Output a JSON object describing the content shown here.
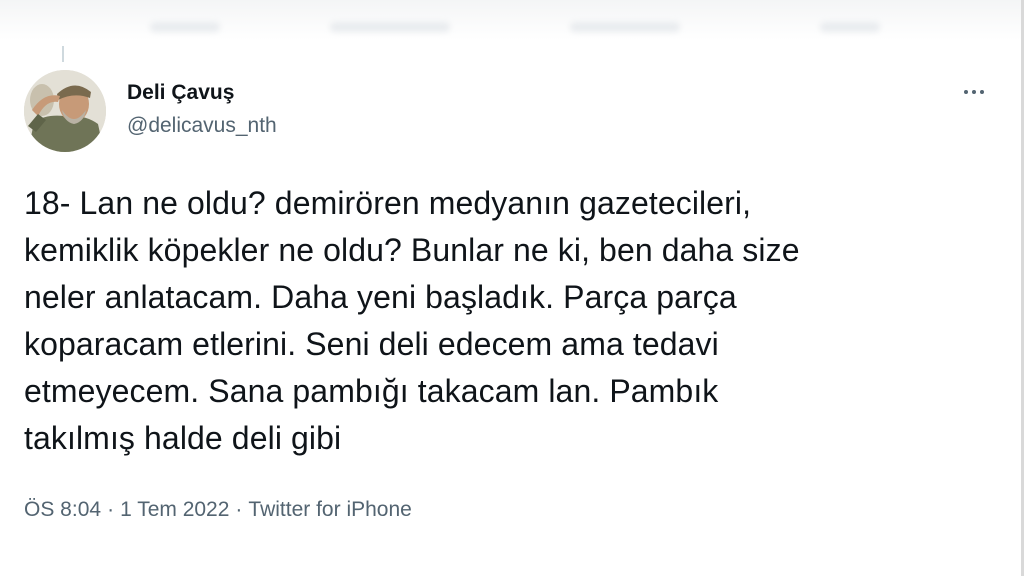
{
  "author": {
    "display_name": "Deli Çavuş",
    "handle": "@delicavus_nth",
    "avatar": "profile-avatar"
  },
  "menu": {
    "icon": "more-horizontal-icon"
  },
  "tweet": {
    "text": "18- Lan ne oldu? demirören medyanın gazetecileri,\nkemiklik köpekler ne oldu? Bunlar ne ki, ben daha size\nneler anlatacam. Daha yeni başladık. Parça parça\nkoparacam etlerini. Seni deli edecem ama tedavi\netmeyecem. Sana pambığı takacam lan. Pambık\ntakılmış halde deli gibi"
  },
  "meta": {
    "time": "ÖS 8:04",
    "date": "1 Tem 2022",
    "source": "Twitter for iPhone",
    "separator": "·"
  }
}
